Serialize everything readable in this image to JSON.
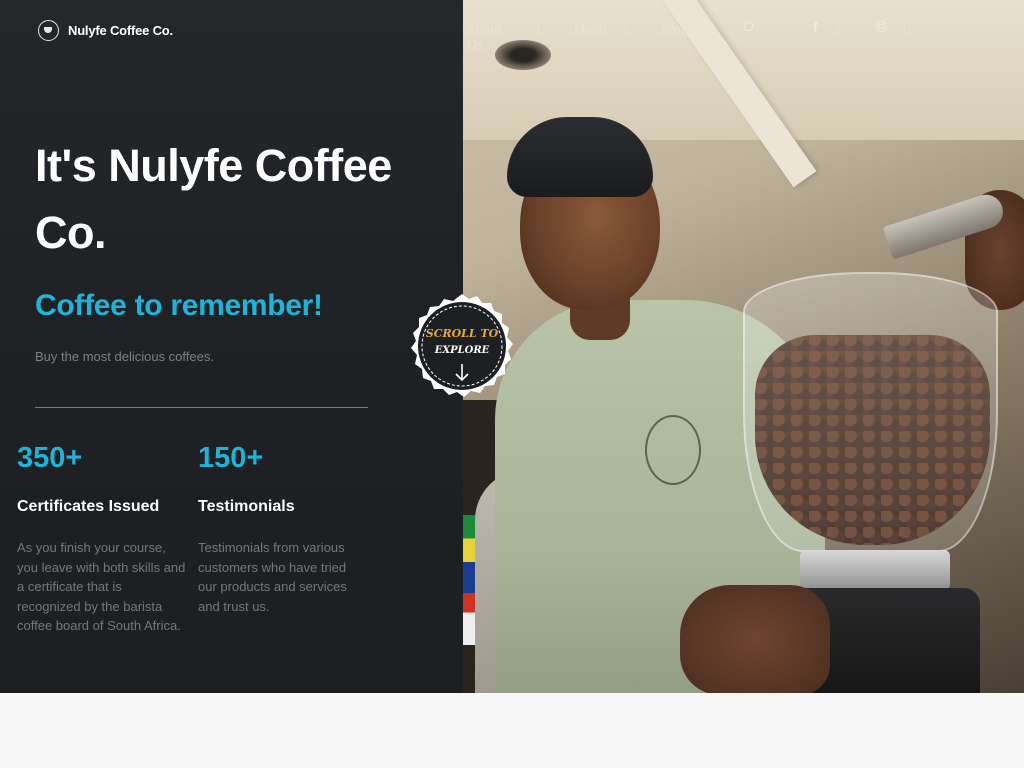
{
  "brand": {
    "name": "Nulyfe Coffee Co."
  },
  "nav": {
    "items": [
      {
        "label": "About Us"
      },
      {
        "label": "Menu"
      },
      {
        "label": "Blog"
      }
    ],
    "social": [
      "whatsapp-icon",
      "facebook-icon",
      "instagram-icon"
    ]
  },
  "hero": {
    "title": "It's Nulyfe Coffee Co.",
    "tagline": "Coffee to remember!",
    "subtext": "Buy the most delicious coffees."
  },
  "scroll_badge": {
    "line1": "SCROLL TO",
    "line2": "EXPLORE"
  },
  "stats": [
    {
      "number": "350+",
      "label": "Certificates Issued",
      "description": "As you finish your course, you leave with both skills and a certificate that is recognized by the barista coffee board of South Africa."
    },
    {
      "number": "150+",
      "label": "Testimonials",
      "description": "Testimonials from various customers who have tried our products and services and trust us."
    }
  ],
  "colors": {
    "accent": "#1fb3d9",
    "panel": "#1e2124",
    "badge_text": "#e8a83a"
  }
}
